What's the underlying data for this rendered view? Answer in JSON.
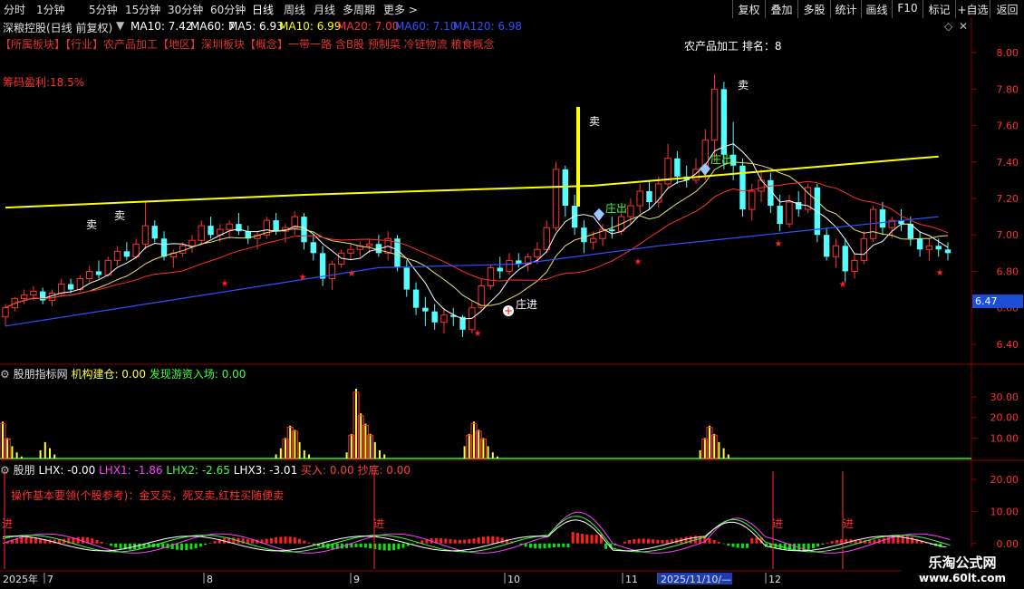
{
  "toolbar": {
    "periods": [
      "分时",
      "1分钟",
      "5分钟",
      "15分钟",
      "30分钟",
      "60分钟",
      "日线",
      "周线",
      "月线",
      "多周期",
      "更多 >"
    ],
    "active_period": "日线",
    "right_buttons": [
      "复权",
      "叠加",
      "多股",
      "统计",
      "画线",
      "F10",
      "标记",
      "+自选",
      "返回"
    ]
  },
  "header": {
    "stock_name": "深粮控股(日线 前复权)",
    "ma_items": [
      {
        "text": "MA10: 7.42",
        "color": "#ffffff"
      },
      {
        "text": "MA60: 7",
        "color": "#ffffff"
      },
      {
        "text": "MA5: 6.93",
        "color": "#ffffff"
      },
      {
        "text": "MA10: 6.99",
        "color": "#ffff00"
      },
      {
        "text": "MA20: 7.00",
        "color": "#ff3030"
      },
      {
        "text": "MA60: 7.10",
        "color": "#3050ff"
      },
      {
        "text": "MA120: 6.98",
        "color": "#3050ff"
      }
    ],
    "sector_line": "【所属板块】【行业】农产品加工【地区】深圳板块【概念】一带一路 含B股 预制菜 冷链物流 粮食概念",
    "rank_label": "农产品加工 排名：8",
    "profit_label": "筹码盈利:18.5%"
  },
  "panels": {
    "indicator1": {
      "name": "股朋指标网",
      "items": [
        {
          "text": "机构建仓: 0.00",
          "color": "#ffff40"
        },
        {
          "text": "发现游资入场: 0.00",
          "color": "#40ff40"
        }
      ]
    },
    "indicator2": {
      "name": "股朋",
      "items": [
        {
          "text": "LHX: -0.00",
          "color": "#ffffff"
        },
        {
          "text": "LHX1: -1.86",
          "color": "#ff40ff"
        },
        {
          "text": "LHX2: -2.65",
          "color": "#40ff40"
        },
        {
          "text": "LHX3: -3.01",
          "color": "#ffffff"
        },
        {
          "text": "买入: 0.00",
          "color": "#ff4040"
        },
        {
          "text": "抄底: 0.00",
          "color": "#ff4040"
        }
      ],
      "note": "操作基本要领(个股参考)：金叉买，死叉卖,红柱买随便卖"
    }
  },
  "annotations": {
    "sell": "卖",
    "entry": "庄进",
    "exit": "庄出",
    "buy_in": "进",
    "price_tag": "6.47",
    "star": "★"
  },
  "timeline": {
    "labels": [
      "2025年",
      "7",
      "8",
      "9",
      "10",
      "11",
      "2025/11/10/—",
      "12"
    ]
  },
  "watermark": {
    "line1": "乐淘公式网",
    "line2": "www.60lt.com"
  },
  "colors": {
    "up": "#ff3232",
    "down": "#54ffff",
    "ma_yellow": "#ffff00",
    "ma_blue": "#3050ff",
    "ma_red": "#ff3030",
    "ma_white": "#ffffff",
    "grid": "#8b0000"
  },
  "chart_data": [
    {
      "type": "candlestick",
      "title": "深粮控股(日线 前复权)",
      "ylim": [
        6.3,
        8.1
      ],
      "y_ticks": [
        6.4,
        6.6,
        6.8,
        7.0,
        7.2,
        7.4,
        7.6,
        7.8,
        8.0
      ],
      "candles": [
        [
          6.55,
          6.62,
          6.5,
          6.6
        ],
        [
          6.6,
          6.66,
          6.58,
          6.65
        ],
        [
          6.65,
          6.7,
          6.62,
          6.67
        ],
        [
          6.67,
          6.72,
          6.64,
          6.69
        ],
        [
          6.69,
          6.71,
          6.62,
          6.64
        ],
        [
          6.64,
          6.7,
          6.61,
          6.68
        ],
        [
          6.68,
          6.76,
          6.66,
          6.73
        ],
        [
          6.73,
          6.76,
          6.68,
          6.7
        ],
        [
          6.7,
          6.78,
          6.69,
          6.76
        ],
        [
          6.76,
          6.83,
          6.74,
          6.8
        ],
        [
          6.8,
          6.86,
          6.76,
          6.78
        ],
        [
          6.78,
          6.88,
          6.77,
          6.86
        ],
        [
          6.86,
          6.94,
          6.83,
          6.91
        ],
        [
          6.91,
          6.96,
          6.86,
          6.88
        ],
        [
          6.88,
          6.98,
          6.87,
          6.95
        ],
        [
          6.95,
          7.18,
          6.92,
          7.05
        ],
        [
          7.05,
          7.08,
          6.96,
          6.98
        ],
        [
          6.98,
          7.02,
          6.86,
          6.88
        ],
        [
          6.88,
          6.92,
          6.82,
          6.9
        ],
        [
          6.9,
          6.96,
          6.88,
          6.94
        ],
        [
          6.94,
          7.0,
          6.9,
          6.97
        ],
        [
          6.97,
          7.08,
          6.95,
          7.05
        ],
        [
          7.05,
          7.1,
          6.98,
          7.0
        ],
        [
          7.0,
          7.06,
          6.96,
          7.03
        ],
        [
          7.03,
          7.08,
          6.98,
          7.06
        ],
        [
          7.06,
          7.12,
          7.0,
          7.02
        ],
        [
          7.02,
          7.05,
          6.95,
          6.98
        ],
        [
          6.98,
          7.02,
          6.92,
          7.0
        ],
        [
          7.0,
          7.1,
          6.98,
          7.08
        ],
        [
          7.08,
          7.12,
          7.0,
          7.02
        ],
        [
          7.02,
          7.06,
          6.96,
          7.04
        ],
        [
          7.04,
          7.13,
          7.0,
          7.1
        ],
        [
          7.1,
          7.12,
          6.92,
          6.96
        ],
        [
          6.96,
          7.0,
          6.86,
          6.9
        ],
        [
          6.9,
          6.94,
          6.72,
          6.76
        ],
        [
          6.76,
          6.86,
          6.7,
          6.84
        ],
        [
          6.84,
          6.92,
          6.82,
          6.9
        ],
        [
          6.9,
          6.95,
          6.86,
          6.92
        ],
        [
          6.92,
          6.96,
          6.88,
          6.94
        ],
        [
          6.94,
          6.98,
          6.9,
          6.95
        ],
        [
          6.95,
          7.0,
          6.88,
          6.9
        ],
        [
          6.9,
          7.02,
          6.86,
          6.98
        ],
        [
          6.98,
          7.0,
          6.8,
          6.82
        ],
        [
          6.82,
          6.86,
          6.66,
          6.7
        ],
        [
          6.7,
          6.74,
          6.56,
          6.6
        ],
        [
          6.6,
          6.66,
          6.5,
          6.58
        ],
        [
          6.58,
          6.62,
          6.48,
          6.52
        ],
        [
          6.52,
          6.6,
          6.46,
          6.56
        ],
        [
          6.56,
          6.6,
          6.5,
          6.55
        ],
        [
          6.55,
          6.56,
          6.44,
          6.48
        ],
        [
          6.48,
          6.64,
          6.46,
          6.6
        ],
        [
          6.6,
          6.76,
          6.58,
          6.72
        ],
        [
          6.72,
          6.84,
          6.7,
          6.82
        ],
        [
          6.82,
          6.88,
          6.76,
          6.8
        ],
        [
          6.8,
          6.9,
          6.78,
          6.86
        ],
        [
          6.86,
          6.9,
          6.82,
          6.84
        ],
        [
          6.84,
          6.9,
          6.8,
          6.88
        ],
        [
          6.88,
          6.96,
          6.84,
          6.92
        ],
        [
          6.92,
          7.08,
          6.9,
          7.04
        ],
        [
          7.04,
          7.4,
          7.02,
          7.36
        ],
        [
          7.36,
          7.38,
          7.1,
          7.16
        ],
        [
          7.16,
          7.22,
          7.0,
          7.04
        ],
        [
          7.04,
          7.08,
          6.9,
          6.96
        ],
        [
          6.96,
          7.02,
          6.92,
          6.98
        ],
        [
          6.98,
          7.06,
          6.94,
          7.03
        ],
        [
          7.03,
          7.1,
          6.98,
          7.02
        ],
        [
          7.02,
          7.12,
          7.0,
          7.1
        ],
        [
          7.1,
          7.2,
          7.06,
          7.16
        ],
        [
          7.16,
          7.28,
          7.12,
          7.24
        ],
        [
          7.24,
          7.3,
          7.14,
          7.18
        ],
        [
          7.18,
          7.32,
          7.15,
          7.28
        ],
        [
          7.28,
          7.5,
          7.26,
          7.42
        ],
        [
          7.42,
          7.46,
          7.28,
          7.32
        ],
        [
          7.32,
          7.38,
          7.26,
          7.3
        ],
        [
          7.3,
          7.42,
          7.28,
          7.36
        ],
        [
          7.36,
          7.58,
          7.3,
          7.52
        ],
        [
          7.52,
          7.88,
          7.4,
          7.8
        ],
        [
          7.8,
          7.84,
          7.36,
          7.44
        ],
        [
          7.44,
          7.62,
          7.3,
          7.38
        ],
        [
          7.38,
          7.42,
          7.1,
          7.14
        ],
        [
          7.14,
          7.28,
          7.08,
          7.24
        ],
        [
          7.24,
          7.36,
          7.18,
          7.3
        ],
        [
          7.3,
          7.34,
          7.12,
          7.16
        ],
        [
          7.16,
          7.22,
          7.02,
          7.06
        ],
        [
          7.06,
          7.22,
          7.04,
          7.18
        ],
        [
          7.18,
          7.24,
          7.1,
          7.14
        ],
        [
          7.14,
          7.28,
          7.12,
          7.26
        ],
        [
          7.26,
          7.28,
          6.96,
          7.0
        ],
        [
          7.0,
          7.04,
          6.86,
          6.88
        ],
        [
          6.88,
          6.98,
          6.82,
          6.94
        ],
        [
          6.94,
          6.98,
          6.74,
          6.8
        ],
        [
          6.8,
          6.9,
          6.76,
          6.86
        ],
        [
          6.86,
          7.02,
          6.84,
          6.98
        ],
        [
          6.98,
          7.16,
          6.96,
          7.14
        ],
        [
          7.14,
          7.18,
          7.0,
          7.04
        ],
        [
          7.04,
          7.1,
          6.98,
          7.08
        ],
        [
          7.08,
          7.14,
          7.02,
          7.06
        ],
        [
          7.06,
          7.1,
          6.94,
          6.98
        ],
        [
          6.98,
          7.02,
          6.88,
          6.92
        ],
        [
          6.92,
          6.98,
          6.86,
          6.94
        ],
        [
          6.94,
          6.98,
          6.88,
          6.92
        ],
        [
          6.92,
          6.96,
          6.86,
          6.9
        ]
      ],
      "ma_series": [
        {
          "name": "MA10",
          "color": "#ffff00",
          "values": [
            [
              0,
              7.15
            ],
            [
              32,
              7.22
            ],
            [
              63,
              7.27
            ],
            [
              100,
              7.43
            ]
          ]
        },
        {
          "name": "MA60",
          "color": "#3050ff",
          "values": [
            [
              0,
              6.5
            ],
            [
              40,
              6.82
            ],
            [
              55,
              6.84
            ],
            [
              70,
              6.94
            ],
            [
              100,
              7.1
            ]
          ]
        }
      ]
    },
    {
      "type": "bar",
      "title": "股朋指标网",
      "ylim": [
        0,
        38
      ],
      "y_ticks": [
        10.0,
        20.0,
        30.0
      ]
    },
    {
      "type": "line",
      "title": "股朋",
      "ylim": [
        -8,
        24
      ],
      "y_ticks": [
        0.0,
        10.0,
        20.0
      ]
    }
  ]
}
